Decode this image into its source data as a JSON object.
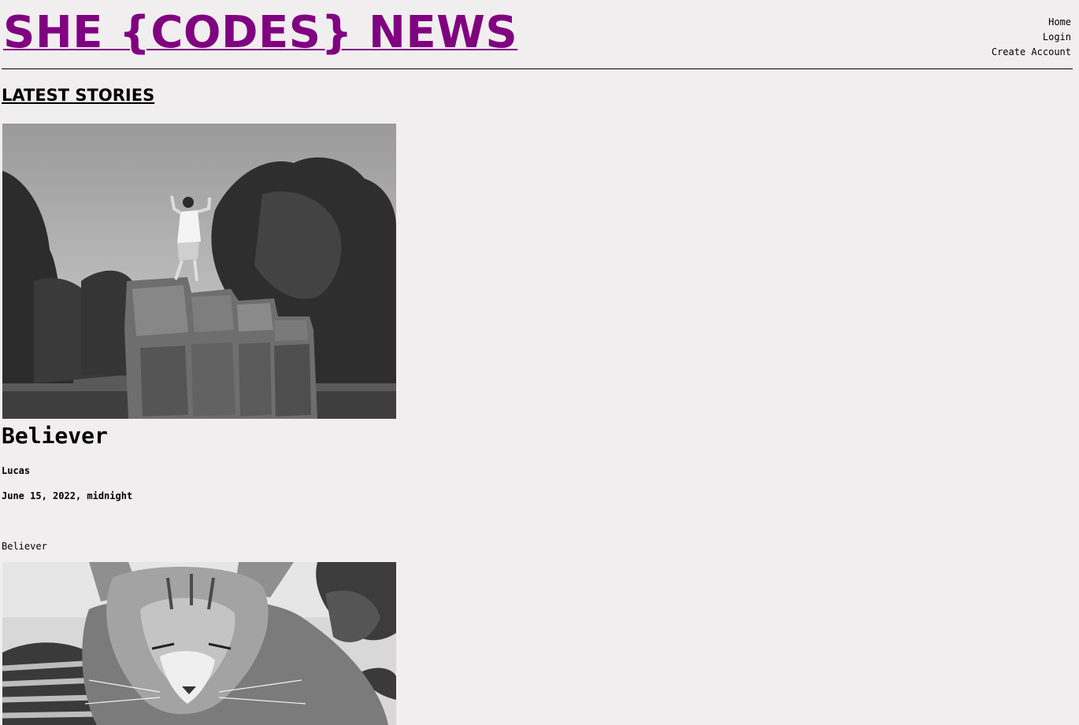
{
  "header": {
    "site_title": "SHE {CODES} NEWS",
    "nav": {
      "home": "Home",
      "login": "Login",
      "create_account": "Create Account"
    }
  },
  "main": {
    "section_title": "LATEST STORIES",
    "stories": [
      {
        "title": "Believer",
        "author": "Lucas",
        "date": "June 15, 2022, midnight",
        "body": "Believer",
        "image": "photo-person-on-rock-sculpture"
      },
      {
        "image": "photo-cat"
      }
    ]
  },
  "colors": {
    "background": "#f0eeef",
    "title_purple": "#800080",
    "text": "#000000"
  }
}
